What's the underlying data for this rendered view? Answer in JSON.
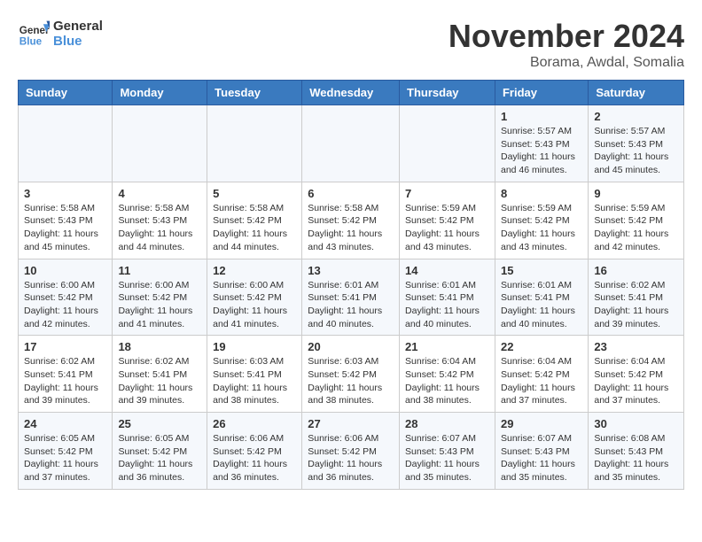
{
  "logo": {
    "text_general": "General",
    "text_blue": "Blue"
  },
  "title": {
    "month_year": "November 2024",
    "location": "Borama, Awdal, Somalia"
  },
  "weekdays": [
    "Sunday",
    "Monday",
    "Tuesday",
    "Wednesday",
    "Thursday",
    "Friday",
    "Saturday"
  ],
  "weeks": [
    [
      {
        "day": "",
        "info": ""
      },
      {
        "day": "",
        "info": ""
      },
      {
        "day": "",
        "info": ""
      },
      {
        "day": "",
        "info": ""
      },
      {
        "day": "",
        "info": ""
      },
      {
        "day": "1",
        "info": "Sunrise: 5:57 AM\nSunset: 5:43 PM\nDaylight: 11 hours and 46 minutes."
      },
      {
        "day": "2",
        "info": "Sunrise: 5:57 AM\nSunset: 5:43 PM\nDaylight: 11 hours and 45 minutes."
      }
    ],
    [
      {
        "day": "3",
        "info": "Sunrise: 5:58 AM\nSunset: 5:43 PM\nDaylight: 11 hours and 45 minutes."
      },
      {
        "day": "4",
        "info": "Sunrise: 5:58 AM\nSunset: 5:43 PM\nDaylight: 11 hours and 44 minutes."
      },
      {
        "day": "5",
        "info": "Sunrise: 5:58 AM\nSunset: 5:42 PM\nDaylight: 11 hours and 44 minutes."
      },
      {
        "day": "6",
        "info": "Sunrise: 5:58 AM\nSunset: 5:42 PM\nDaylight: 11 hours and 43 minutes."
      },
      {
        "day": "7",
        "info": "Sunrise: 5:59 AM\nSunset: 5:42 PM\nDaylight: 11 hours and 43 minutes."
      },
      {
        "day": "8",
        "info": "Sunrise: 5:59 AM\nSunset: 5:42 PM\nDaylight: 11 hours and 43 minutes."
      },
      {
        "day": "9",
        "info": "Sunrise: 5:59 AM\nSunset: 5:42 PM\nDaylight: 11 hours and 42 minutes."
      }
    ],
    [
      {
        "day": "10",
        "info": "Sunrise: 6:00 AM\nSunset: 5:42 PM\nDaylight: 11 hours and 42 minutes."
      },
      {
        "day": "11",
        "info": "Sunrise: 6:00 AM\nSunset: 5:42 PM\nDaylight: 11 hours and 41 minutes."
      },
      {
        "day": "12",
        "info": "Sunrise: 6:00 AM\nSunset: 5:42 PM\nDaylight: 11 hours and 41 minutes."
      },
      {
        "day": "13",
        "info": "Sunrise: 6:01 AM\nSunset: 5:41 PM\nDaylight: 11 hours and 40 minutes."
      },
      {
        "day": "14",
        "info": "Sunrise: 6:01 AM\nSunset: 5:41 PM\nDaylight: 11 hours and 40 minutes."
      },
      {
        "day": "15",
        "info": "Sunrise: 6:01 AM\nSunset: 5:41 PM\nDaylight: 11 hours and 40 minutes."
      },
      {
        "day": "16",
        "info": "Sunrise: 6:02 AM\nSunset: 5:41 PM\nDaylight: 11 hours and 39 minutes."
      }
    ],
    [
      {
        "day": "17",
        "info": "Sunrise: 6:02 AM\nSunset: 5:41 PM\nDaylight: 11 hours and 39 minutes."
      },
      {
        "day": "18",
        "info": "Sunrise: 6:02 AM\nSunset: 5:41 PM\nDaylight: 11 hours and 39 minutes."
      },
      {
        "day": "19",
        "info": "Sunrise: 6:03 AM\nSunset: 5:41 PM\nDaylight: 11 hours and 38 minutes."
      },
      {
        "day": "20",
        "info": "Sunrise: 6:03 AM\nSunset: 5:42 PM\nDaylight: 11 hours and 38 minutes."
      },
      {
        "day": "21",
        "info": "Sunrise: 6:04 AM\nSunset: 5:42 PM\nDaylight: 11 hours and 38 minutes."
      },
      {
        "day": "22",
        "info": "Sunrise: 6:04 AM\nSunset: 5:42 PM\nDaylight: 11 hours and 37 minutes."
      },
      {
        "day": "23",
        "info": "Sunrise: 6:04 AM\nSunset: 5:42 PM\nDaylight: 11 hours and 37 minutes."
      }
    ],
    [
      {
        "day": "24",
        "info": "Sunrise: 6:05 AM\nSunset: 5:42 PM\nDaylight: 11 hours and 37 minutes."
      },
      {
        "day": "25",
        "info": "Sunrise: 6:05 AM\nSunset: 5:42 PM\nDaylight: 11 hours and 36 minutes."
      },
      {
        "day": "26",
        "info": "Sunrise: 6:06 AM\nSunset: 5:42 PM\nDaylight: 11 hours and 36 minutes."
      },
      {
        "day": "27",
        "info": "Sunrise: 6:06 AM\nSunset: 5:42 PM\nDaylight: 11 hours and 36 minutes."
      },
      {
        "day": "28",
        "info": "Sunrise: 6:07 AM\nSunset: 5:43 PM\nDaylight: 11 hours and 35 minutes."
      },
      {
        "day": "29",
        "info": "Sunrise: 6:07 AM\nSunset: 5:43 PM\nDaylight: 11 hours and 35 minutes."
      },
      {
        "day": "30",
        "info": "Sunrise: 6:08 AM\nSunset: 5:43 PM\nDaylight: 11 hours and 35 minutes."
      }
    ]
  ]
}
